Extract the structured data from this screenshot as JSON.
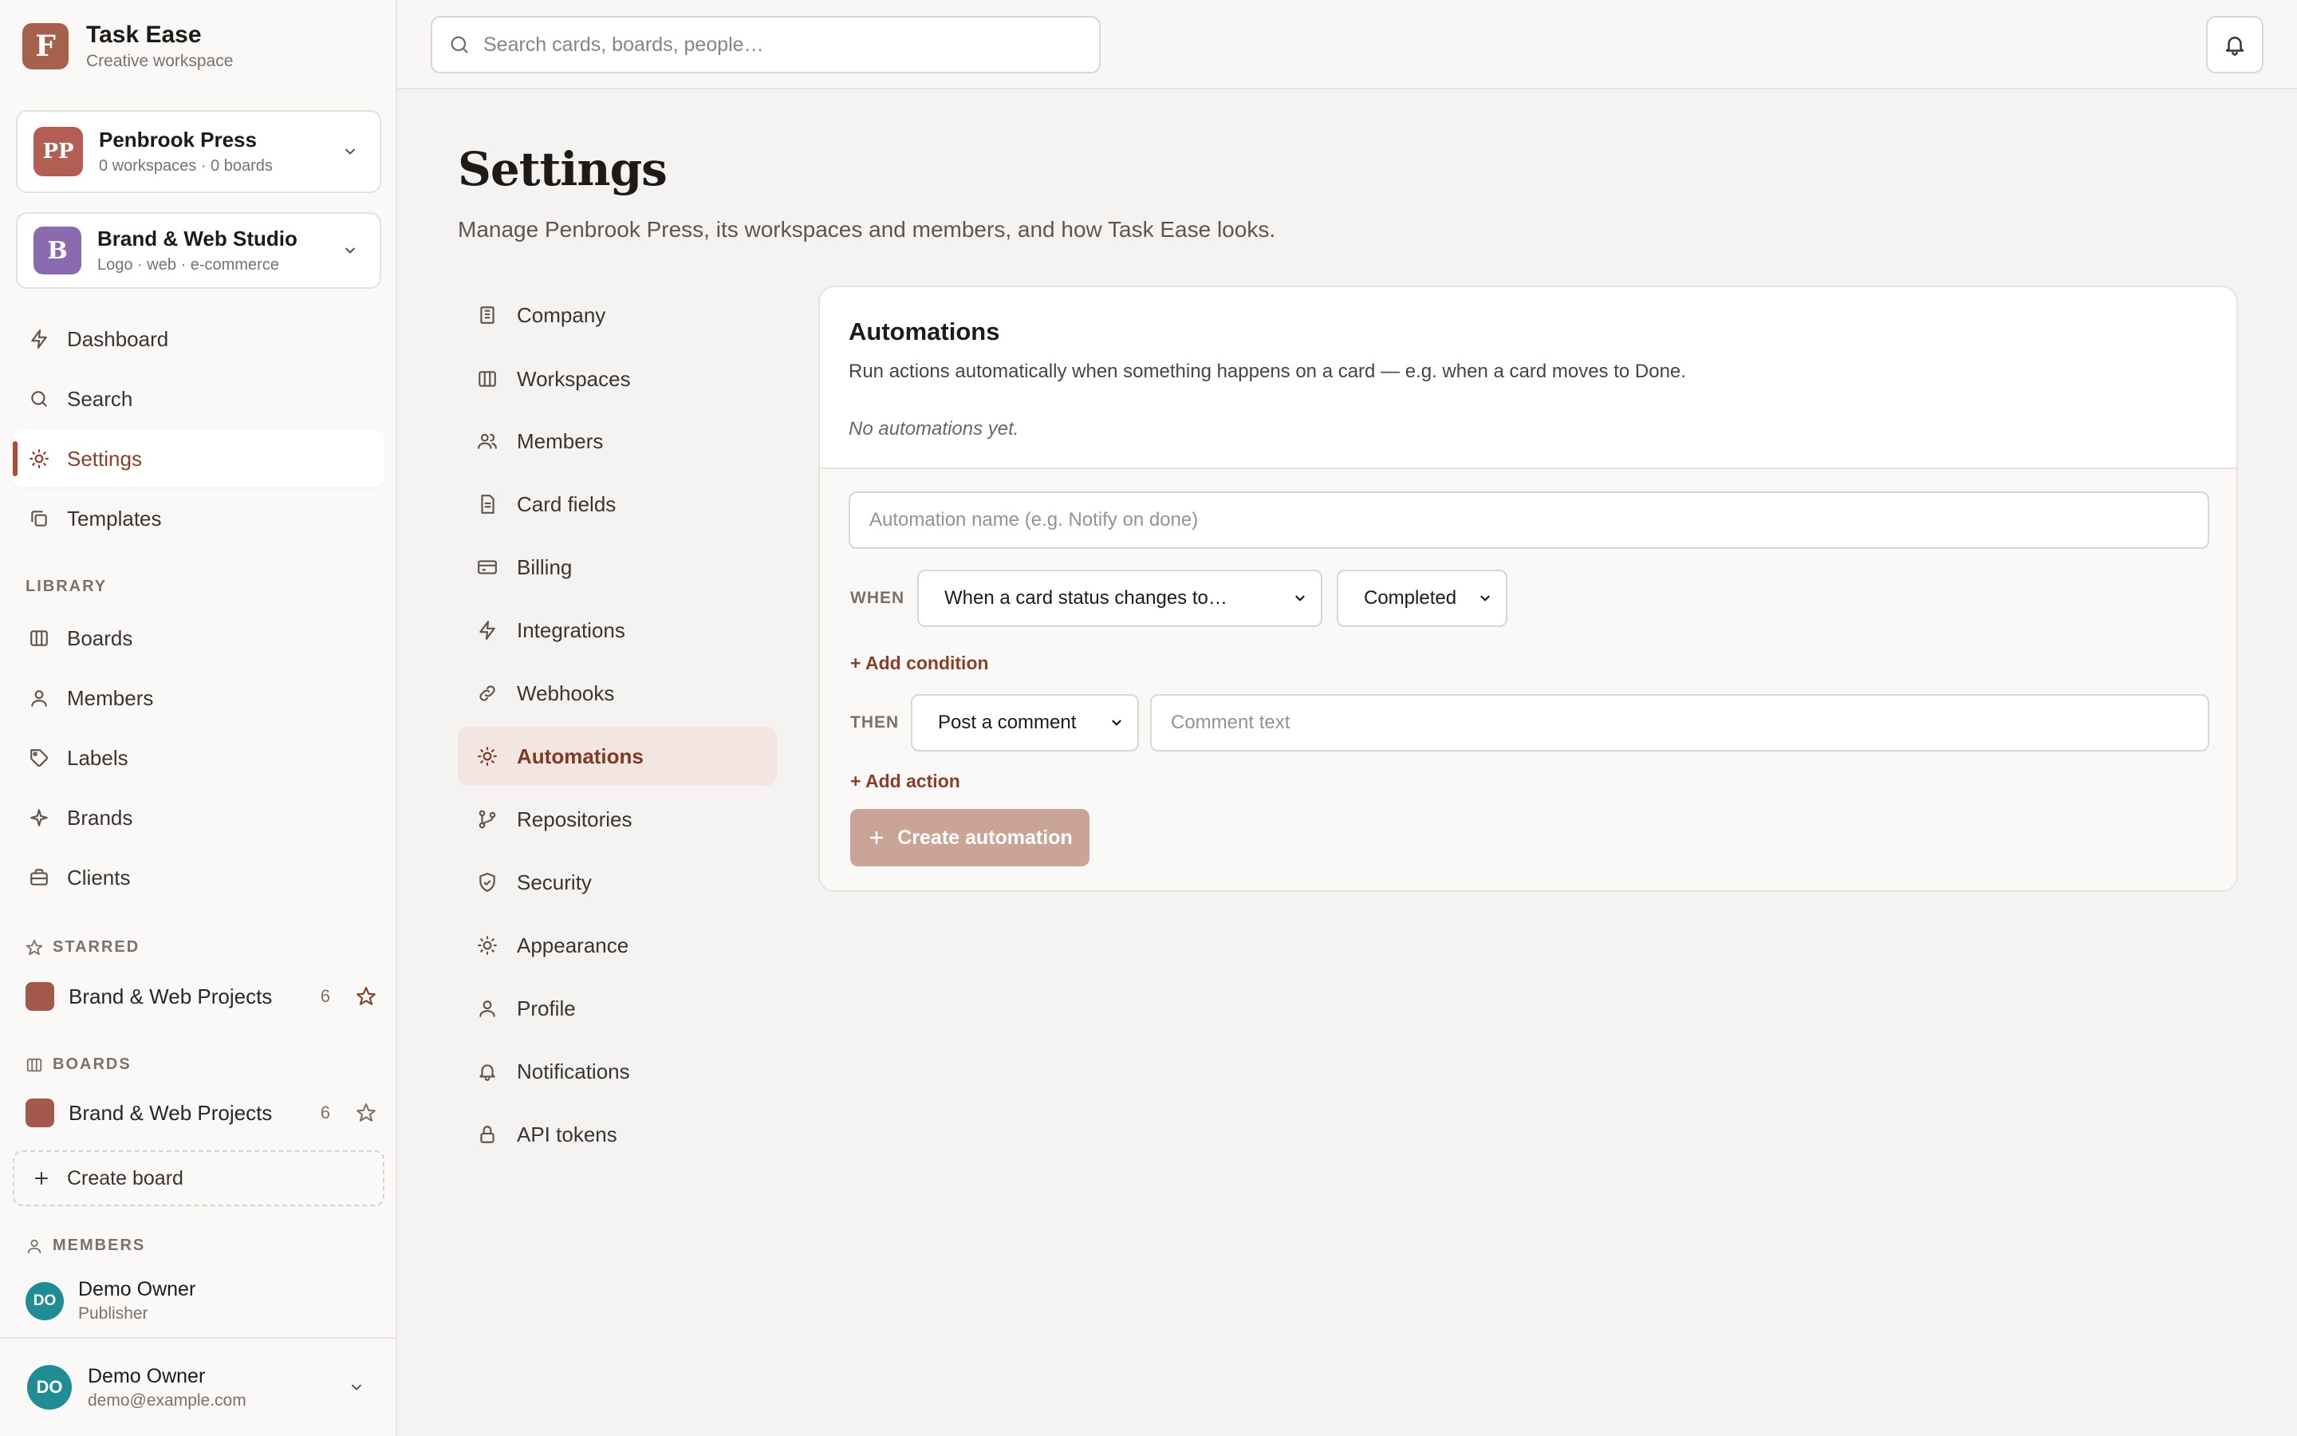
{
  "app": {
    "name": "Task Ease",
    "subtitle": "Creative workspace",
    "logo_letter": "F",
    "accent": "#a04f38"
  },
  "orgs": [
    {
      "initials": "PP",
      "name": "Penbrook Press",
      "meta": "0 workspaces · 0 boards",
      "color": "#b35e52"
    },
    {
      "initials": "B",
      "name": "Brand & Web Studio",
      "meta": "Logo · web · e-commerce",
      "color": "#8a6bb0"
    }
  ],
  "nav": [
    {
      "label": "Dashboard",
      "icon": "bolt-icon"
    },
    {
      "label": "Search",
      "icon": "search-icon"
    },
    {
      "label": "Settings",
      "icon": "sun-icon",
      "active": true
    },
    {
      "label": "Templates",
      "icon": "copy-icon"
    }
  ],
  "library": {
    "heading": "LIBRARY",
    "items": [
      {
        "label": "Boards",
        "icon": "columns-icon"
      },
      {
        "label": "Members",
        "icon": "user-icon"
      },
      {
        "label": "Labels",
        "icon": "tag-icon"
      },
      {
        "label": "Brands",
        "icon": "sparkle-icon"
      },
      {
        "label": "Clients",
        "icon": "briefcase-icon"
      }
    ]
  },
  "starred": {
    "heading": "STARRED",
    "boards": [
      {
        "name": "Brand & Web Projects",
        "count": "6"
      }
    ]
  },
  "boards": {
    "heading": "BOARDS",
    "items": [
      {
        "name": "Brand & Web Projects",
        "count": "6"
      }
    ],
    "create_label": "Create board"
  },
  "members": {
    "heading": "MEMBERS",
    "items": [
      {
        "initials": "DO",
        "name": "Demo Owner",
        "role": "Publisher"
      }
    ]
  },
  "current_user": {
    "initials": "DO",
    "name": "Demo Owner",
    "email": "demo@example.com"
  },
  "topbar": {
    "search_placeholder": "Search cards, boards, people…"
  },
  "page": {
    "title": "Settings",
    "subtitle": "Manage Penbrook Press, its workspaces and members, and how Task Ease looks."
  },
  "settings_nav": [
    {
      "label": "Company",
      "icon": "building-icon"
    },
    {
      "label": "Workspaces",
      "icon": "columns-icon"
    },
    {
      "label": "Members",
      "icon": "users-icon"
    },
    {
      "label": "Card fields",
      "icon": "document-icon"
    },
    {
      "label": "Billing",
      "icon": "credit-card-icon"
    },
    {
      "label": "Integrations",
      "icon": "bolt-icon"
    },
    {
      "label": "Webhooks",
      "icon": "link-icon"
    },
    {
      "label": "Automations",
      "icon": "sun-icon",
      "active": true
    },
    {
      "label": "Repositories",
      "icon": "git-branch-icon"
    },
    {
      "label": "Security",
      "icon": "shield-icon"
    },
    {
      "label": "Appearance",
      "icon": "sun-icon"
    },
    {
      "label": "Profile",
      "icon": "user-icon"
    },
    {
      "label": "Notifications",
      "icon": "bell-icon"
    },
    {
      "label": "API tokens",
      "icon": "lock-icon"
    }
  ],
  "automations": {
    "title": "Automations",
    "description": "Run actions automatically when something happens on a card — e.g. when a card moves to Done.",
    "empty": "No automations yet.",
    "name_placeholder": "Automation name (e.g. Notify on done)",
    "when_label": "WHEN",
    "trigger": "When a card status changes to…",
    "trigger_value": "Completed",
    "add_condition": "+ Add condition",
    "then_label": "THEN",
    "action": "Post a comment",
    "comment_placeholder": "Comment text",
    "add_action": "+ Add action",
    "create_label": "Create automation"
  }
}
